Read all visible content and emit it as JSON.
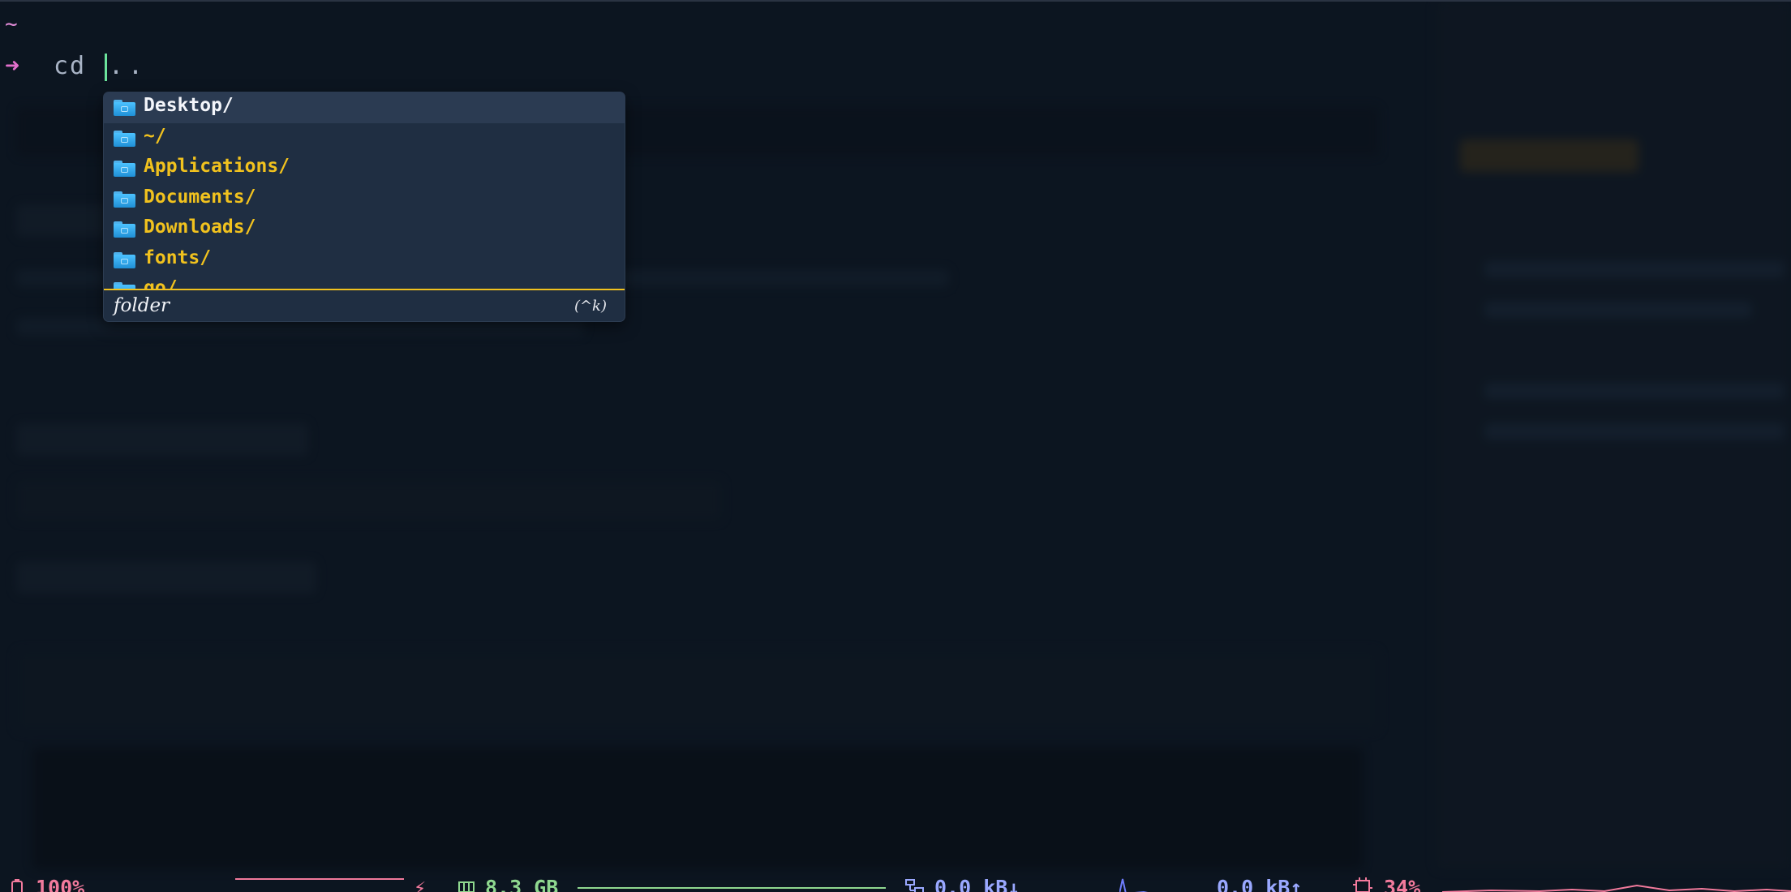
{
  "prompt": {
    "directory": "~",
    "arrow": "➜",
    "command": "cd",
    "argument": ".."
  },
  "completion": {
    "items": [
      {
        "label": "Desktop/",
        "icon": "folder-icon",
        "selected": true
      },
      {
        "label": "~/",
        "icon": "folder-icon"
      },
      {
        "label": "Applications/",
        "icon": "folder-icon"
      },
      {
        "label": "Documents/",
        "icon": "folder-icon"
      },
      {
        "label": "Downloads/",
        "icon": "folder-icon"
      },
      {
        "label": "fonts/",
        "icon": "folder-icon"
      },
      {
        "label": "go/",
        "icon": "folder-icon"
      }
    ],
    "footer_label": "folder",
    "footer_hint": "(^k)",
    "accent_color": "#f1c21e"
  },
  "statusbar": {
    "battery": "100%",
    "memory": "8.3 GB",
    "net_down": "0.0 kB↓",
    "net_up": "0.0 kB↑",
    "cpu": "34%",
    "colors": {
      "battery": "#f27a9c",
      "memory": "#8fd88f",
      "network": "#9aa8ff",
      "cpu": "#f27a9c"
    }
  }
}
